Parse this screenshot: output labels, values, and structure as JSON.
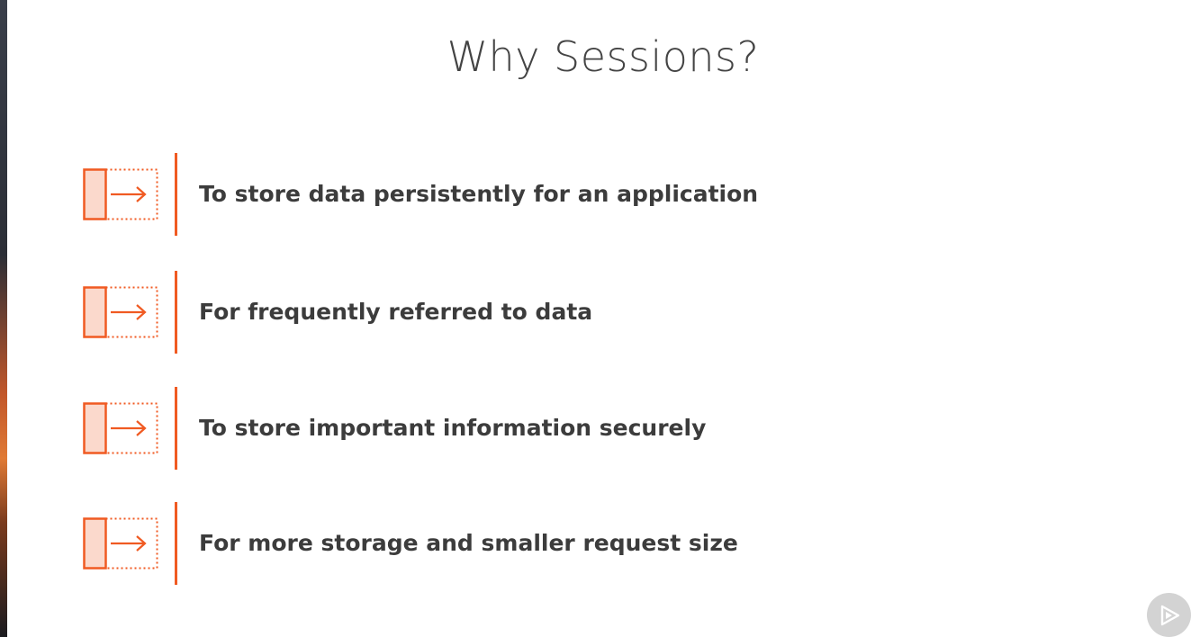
{
  "slide": {
    "title": "Why Sessions?"
  },
  "bullets": [
    {
      "text": "To store data persistently for an application",
      "icon": "box-arrow-right-icon"
    },
    {
      "text": "For frequently referred to data",
      "icon": "box-arrow-right-icon"
    },
    {
      "text": "To store important information securely",
      "icon": "box-arrow-right-icon"
    },
    {
      "text": "For more storage and smaller request size",
      "icon": "box-arrow-right-icon"
    }
  ],
  "player": {
    "icon": "play-icon"
  },
  "colors": {
    "accent": "#f05a22",
    "accent_fill": "#fbd9cc",
    "text": "#3c3c3c",
    "title": "#444444",
    "play_bg": "#d3d3d3"
  }
}
